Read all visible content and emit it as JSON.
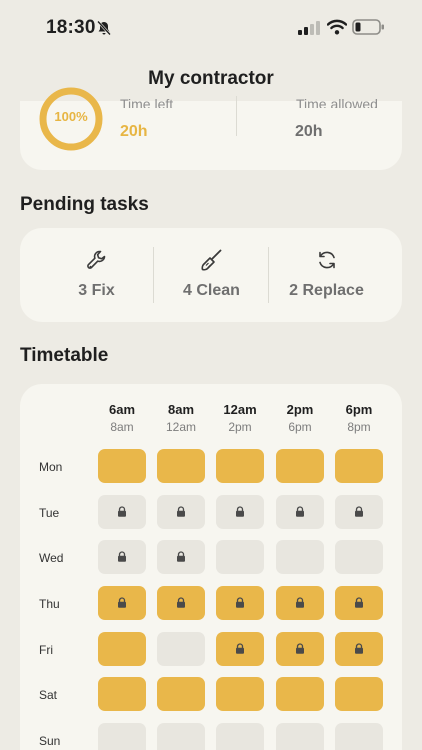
{
  "status_bar": {
    "time": "18:30"
  },
  "header": {
    "title": "My contractor"
  },
  "summary": {
    "progress_percent": 100,
    "progress_label": "100%",
    "time_left_label": "Time left",
    "time_left_value": "20h",
    "time_allowed_label": "Time allowed",
    "time_allowed_value": "20h"
  },
  "pending": {
    "title": "Pending tasks",
    "tasks": [
      {
        "icon": "wrench-icon",
        "label": "3 Fix"
      },
      {
        "icon": "brush-icon",
        "label": "4 Clean"
      },
      {
        "icon": "refresh-icon",
        "label": "2 Replace"
      }
    ]
  },
  "timetable": {
    "title": "Timetable",
    "columns": [
      {
        "start": "6am",
        "end": "8am"
      },
      {
        "start": "8am",
        "end": "12am"
      },
      {
        "start": "12am",
        "end": "2pm"
      },
      {
        "start": "2pm",
        "end": "6pm"
      },
      {
        "start": "6pm",
        "end": "8pm"
      }
    ],
    "rows": [
      {
        "day": "Mon",
        "slots": [
          {
            "state": "booked",
            "locked": false
          },
          {
            "state": "booked",
            "locked": false
          },
          {
            "state": "booked",
            "locked": false
          },
          {
            "state": "booked",
            "locked": false
          },
          {
            "state": "booked",
            "locked": false
          }
        ]
      },
      {
        "day": "Tue",
        "slots": [
          {
            "state": "free",
            "locked": true
          },
          {
            "state": "free",
            "locked": true
          },
          {
            "state": "free",
            "locked": true
          },
          {
            "state": "free",
            "locked": true
          },
          {
            "state": "free",
            "locked": true
          }
        ]
      },
      {
        "day": "Wed",
        "slots": [
          {
            "state": "free",
            "locked": true
          },
          {
            "state": "free",
            "locked": true
          },
          {
            "state": "free",
            "locked": false
          },
          {
            "state": "free",
            "locked": false
          },
          {
            "state": "free",
            "locked": false
          }
        ]
      },
      {
        "day": "Thu",
        "slots": [
          {
            "state": "booked",
            "locked": true
          },
          {
            "state": "booked",
            "locked": true
          },
          {
            "state": "booked",
            "locked": true
          },
          {
            "state": "booked",
            "locked": true
          },
          {
            "state": "booked",
            "locked": true
          }
        ]
      },
      {
        "day": "Fri",
        "slots": [
          {
            "state": "booked",
            "locked": false
          },
          {
            "state": "free",
            "locked": false
          },
          {
            "state": "booked",
            "locked": true
          },
          {
            "state": "booked",
            "locked": true
          },
          {
            "state": "booked",
            "locked": true
          }
        ]
      },
      {
        "day": "Sat",
        "slots": [
          {
            "state": "booked",
            "locked": false
          },
          {
            "state": "booked",
            "locked": false
          },
          {
            "state": "booked",
            "locked": false
          },
          {
            "state": "booked",
            "locked": false
          },
          {
            "state": "booked",
            "locked": false
          }
        ]
      },
      {
        "day": "Sun",
        "slots": [
          {
            "state": "free",
            "locked": false
          },
          {
            "state": "free",
            "locked": false
          },
          {
            "state": "free",
            "locked": false
          },
          {
            "state": "free",
            "locked": false
          },
          {
            "state": "free",
            "locked": false
          }
        ]
      }
    ]
  },
  "colors": {
    "accent": "#e9b74a",
    "background": "#edebe4",
    "card": "#f7f6f0",
    "slot_free": "#e8e6df"
  }
}
